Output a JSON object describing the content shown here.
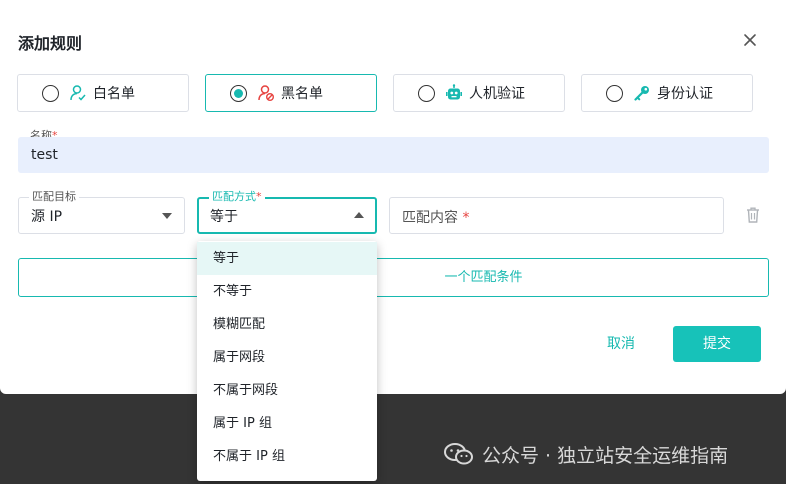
{
  "dialog": {
    "title": "添加规则"
  },
  "rule_types": [
    {
      "label": "白名单",
      "selected": false,
      "icon": "user-check-icon"
    },
    {
      "label": "黑名单",
      "selected": true,
      "icon": "user-block-icon"
    },
    {
      "label": "人机验证",
      "selected": false,
      "icon": "robot-icon"
    },
    {
      "label": "身份认证",
      "selected": false,
      "icon": "key-icon"
    }
  ],
  "name_field": {
    "label": "名称",
    "required_mark": "*",
    "value": "test"
  },
  "match_target": {
    "label": "匹配目标",
    "value": "源 IP"
  },
  "match_method": {
    "label": "匹配方式",
    "required_mark": "*",
    "value": "等于"
  },
  "match_content": {
    "placeholder": "匹配内容",
    "required_mark": "*"
  },
  "add_condition": {
    "label_visible": "一个匹配条件"
  },
  "footer": {
    "cancel": "取消",
    "submit": "提交"
  },
  "dropdown_options": [
    "等于",
    "不等于",
    "模糊匹配",
    "属于网段",
    "不属于网段",
    "属于 IP 组",
    "不属于 IP 组"
  ],
  "watermark": {
    "text": "公众号 · 独立站安全运维指南"
  },
  "colors": {
    "accent": "#17b9b0",
    "name_bg": "#e8effd",
    "required": "#e64340"
  }
}
